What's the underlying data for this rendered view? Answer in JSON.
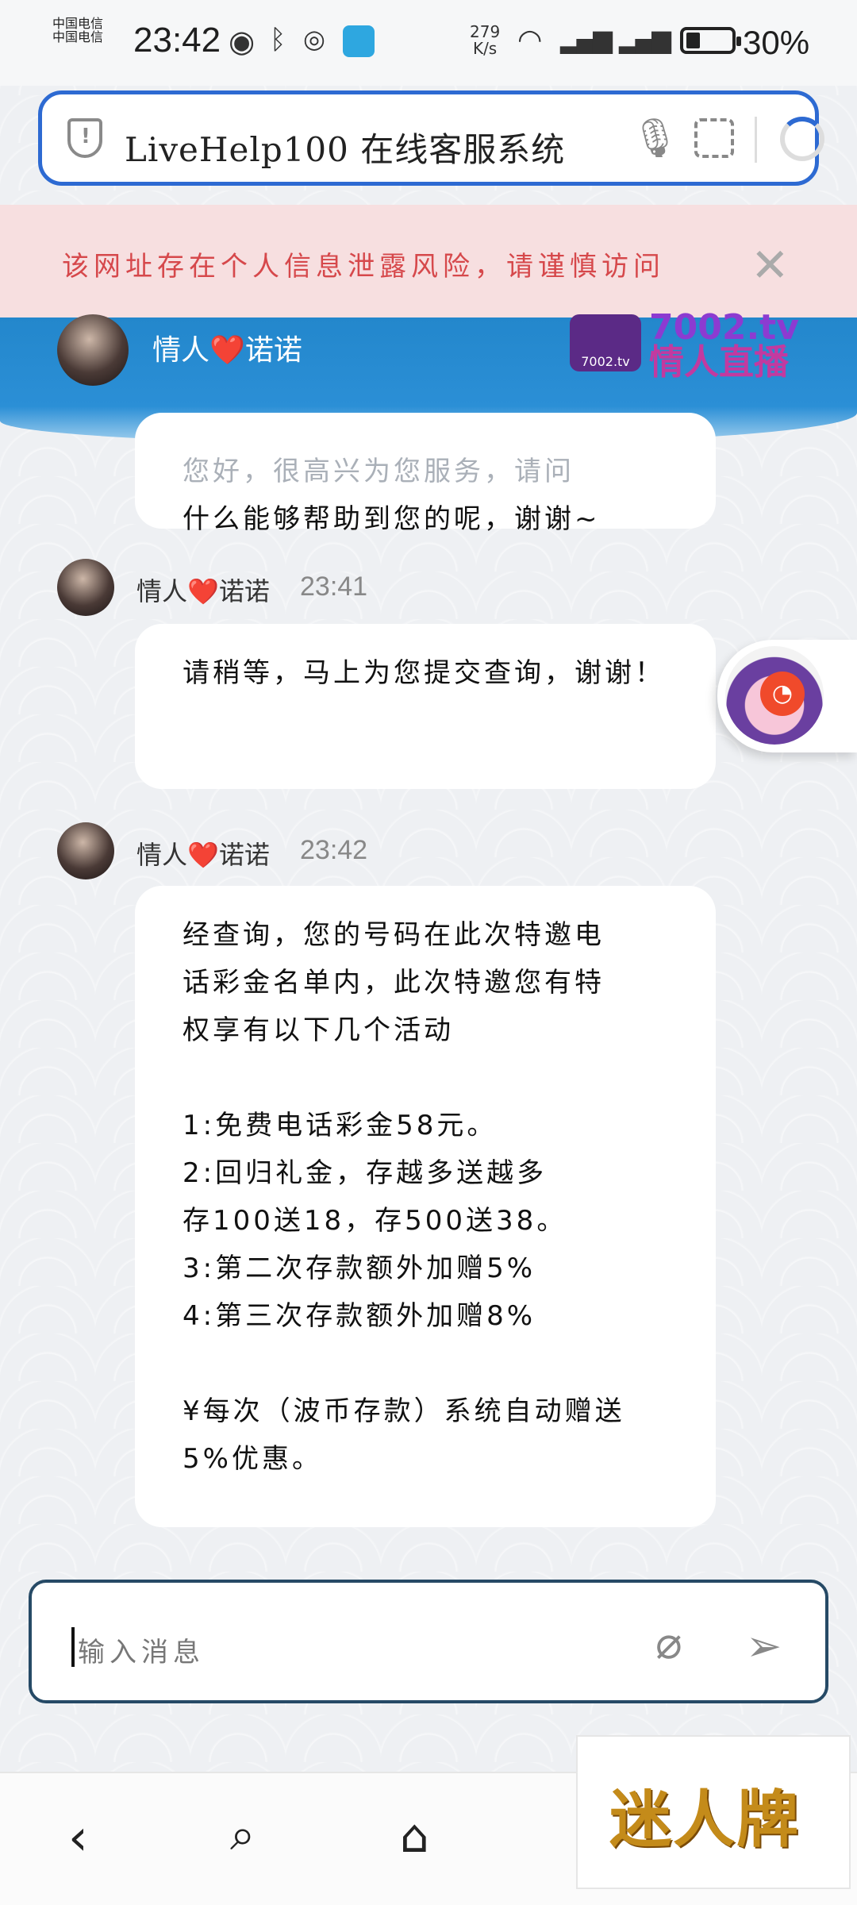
{
  "status_bar": {
    "carrier_line1": "中国电信",
    "carrier_line2": "中国电信",
    "time": "23:42",
    "net_speed": "279",
    "net_unit": "K/s",
    "battery": "30%"
  },
  "url_bar": {
    "url": "LiveHelp100 在线客服系统"
  },
  "warning": {
    "text": "该网址存在个人信息泄露风险，请谨慎访问"
  },
  "header": {
    "agent_name": "情人❤️诺诺",
    "brand_domain": "7002.tv",
    "brand_name": "情人直播",
    "logo_text": "7002.tv"
  },
  "messages": [
    {
      "sender": "情人❤️诺诺",
      "time": "",
      "faded_line": "您好，很高兴为您服务，请问",
      "text": "什么能够帮助到您的呢，谢谢~"
    },
    {
      "sender": "情人❤️诺诺",
      "time": "23:41",
      "text": "请稍等，马上为您提交查询，谢谢！"
    },
    {
      "sender": "情人❤️诺诺",
      "time": "23:42",
      "lines": [
        "经查询，您的号码在此次特邀电",
        "话彩金名单内，此次特邀您有特",
        "权享有以下几个活动",
        "",
        "1:免费电话彩金58元。",
        "2:回归礼金，存越多送越多",
        "存100送18，存500送38。",
        "3:第二次存款额外加赠5%",
        "4:第三次存款额外加赠8%",
        "",
        "¥每次（波币存款）系统自动赠送",
        "5%优惠。"
      ]
    }
  ],
  "composer": {
    "placeholder": "输入消息"
  },
  "promo": {
    "text": "迷人牌"
  },
  "colors": {
    "accent": "#2d6ad2",
    "warning_bg": "#f7dfe0",
    "warning_text": "#d6484b",
    "header_blue": "#2387cc"
  },
  "icons": {
    "eye": "eye-icon",
    "bluetooth": "bluetooth-icon",
    "wifi": "wifi-icon",
    "signal": "signal-icon",
    "mic": "mic-icon",
    "scan": "scan-icon",
    "refresh": "refresh-icon",
    "close": "close-icon",
    "attach": "paperclip-icon",
    "send": "send-icon",
    "back": "back-icon",
    "search": "search-icon",
    "home": "home-icon"
  }
}
